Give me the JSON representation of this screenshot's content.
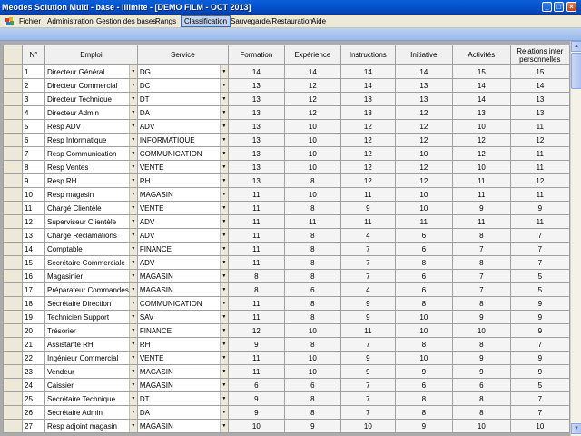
{
  "window": {
    "title": "Meodes Solution Multi - base - Illimite - [DEMO FILM - OCT 2013]",
    "controls": {
      "minimize": "_",
      "maximize": "□",
      "close": "×"
    }
  },
  "menu": {
    "items": [
      {
        "label": "Fichier",
        "active": false
      },
      {
        "label": "Administration",
        "active": false
      },
      {
        "label": "Gestion des bases",
        "active": false
      },
      {
        "label": "Rangs",
        "active": false
      },
      {
        "label": "Classification",
        "active": true
      },
      {
        "label": "Sauvegarde/Restauration",
        "active": false
      },
      {
        "label": "Aide",
        "active": false
      }
    ]
  },
  "grid": {
    "headers": {
      "num": "N°",
      "emploi": "Emploi",
      "service": "Service",
      "formation": "Formation",
      "experience": "Expérience",
      "instructions": "Instructions",
      "initiative": "Initiative",
      "activites": "Activités",
      "relations": "Relations inter personnelles"
    },
    "rows": [
      {
        "n": "1",
        "emploi": "Directeur Général",
        "service": "DG",
        "formation": "14",
        "experience": "14",
        "instructions": "14",
        "initiative": "14",
        "activites": "15",
        "relations": "15"
      },
      {
        "n": "2",
        "emploi": "Directeur Commercial",
        "service": "DC",
        "formation": "13",
        "experience": "12",
        "instructions": "14",
        "initiative": "13",
        "activites": "14",
        "relations": "14"
      },
      {
        "n": "3",
        "emploi": "Directeur Technique",
        "service": "DT",
        "formation": "13",
        "experience": "12",
        "instructions": "13",
        "initiative": "13",
        "activites": "14",
        "relations": "13"
      },
      {
        "n": "4",
        "emploi": "Directeur Admin",
        "service": "DA",
        "formation": "13",
        "experience": "12",
        "instructions": "13",
        "initiative": "12",
        "activites": "13",
        "relations": "13"
      },
      {
        "n": "5",
        "emploi": "Resp ADV",
        "service": "ADV",
        "formation": "13",
        "experience": "10",
        "instructions": "12",
        "initiative": "12",
        "activites": "10",
        "relations": "11"
      },
      {
        "n": "6",
        "emploi": "Resp Informatique",
        "service": "INFORMATIQUE",
        "formation": "13",
        "experience": "10",
        "instructions": "12",
        "initiative": "12",
        "activites": "12",
        "relations": "12"
      },
      {
        "n": "7",
        "emploi": "Resp Communication",
        "service": "COMMUNICATION",
        "formation": "13",
        "experience": "10",
        "instructions": "12",
        "initiative": "10",
        "activites": "12",
        "relations": "11"
      },
      {
        "n": "8",
        "emploi": "Resp Ventes",
        "service": "VENTE",
        "formation": "13",
        "experience": "10",
        "instructions": "12",
        "initiative": "12",
        "activites": "10",
        "relations": "11"
      },
      {
        "n": "9",
        "emploi": "Resp RH",
        "service": "RH",
        "formation": "13",
        "experience": "8",
        "instructions": "12",
        "initiative": "12",
        "activites": "11",
        "relations": "12"
      },
      {
        "n": "10",
        "emploi": "Resp magasin",
        "service": "MAGASIN",
        "formation": "11",
        "experience": "10",
        "instructions": "11",
        "initiative": "10",
        "activites": "11",
        "relations": "11"
      },
      {
        "n": "11",
        "emploi": "Chargé Clientèle",
        "service": "VENTE",
        "formation": "11",
        "experience": "8",
        "instructions": "9",
        "initiative": "10",
        "activites": "9",
        "relations": "9"
      },
      {
        "n": "12",
        "emploi": "Superviseur Clientèle",
        "service": "ADV",
        "formation": "11",
        "experience": "11",
        "instructions": "11",
        "initiative": "11",
        "activites": "11",
        "relations": "11"
      },
      {
        "n": "13",
        "emploi": "Chargé Réclamations",
        "service": "ADV",
        "formation": "11",
        "experience": "8",
        "instructions": "4",
        "initiative": "6",
        "activites": "8",
        "relations": "7"
      },
      {
        "n": "14",
        "emploi": "Comptable",
        "service": "FINANCE",
        "formation": "11",
        "experience": "8",
        "instructions": "7",
        "initiative": "6",
        "activites": "7",
        "relations": "7"
      },
      {
        "n": "15",
        "emploi": "Secrétaire Commerciale",
        "service": "ADV",
        "formation": "11",
        "experience": "8",
        "instructions": "7",
        "initiative": "8",
        "activites": "8",
        "relations": "7"
      },
      {
        "n": "16",
        "emploi": "Magasinier",
        "service": "MAGASIN",
        "formation": "8",
        "experience": "8",
        "instructions": "7",
        "initiative": "6",
        "activites": "7",
        "relations": "5"
      },
      {
        "n": "17",
        "emploi": "Préparateur Commandes",
        "service": "MAGASIN",
        "formation": "8",
        "experience": "6",
        "instructions": "4",
        "initiative": "6",
        "activites": "7",
        "relations": "5"
      },
      {
        "n": "18",
        "emploi": "Secrétaire Direction",
        "service": "COMMUNICATION",
        "formation": "11",
        "experience": "8",
        "instructions": "9",
        "initiative": "8",
        "activites": "8",
        "relations": "9"
      },
      {
        "n": "19",
        "emploi": "Technicien Support",
        "service": "SAV",
        "formation": "11",
        "experience": "8",
        "instructions": "9",
        "initiative": "10",
        "activites": "9",
        "relations": "9"
      },
      {
        "n": "20",
        "emploi": "Trésorier",
        "service": "FINANCE",
        "formation": "12",
        "experience": "10",
        "instructions": "11",
        "initiative": "10",
        "activites": "10",
        "relations": "9"
      },
      {
        "n": "21",
        "emploi": "Assistante RH",
        "service": "RH",
        "formation": "9",
        "experience": "8",
        "instructions": "7",
        "initiative": "8",
        "activites": "8",
        "relations": "7"
      },
      {
        "n": "22",
        "emploi": "Ingénieur Commercial",
        "service": "VENTE",
        "formation": "11",
        "experience": "10",
        "instructions": "9",
        "initiative": "10",
        "activites": "9",
        "relations": "9"
      },
      {
        "n": "23",
        "emploi": "Vendeur",
        "service": "MAGASIN",
        "formation": "11",
        "experience": "10",
        "instructions": "9",
        "initiative": "9",
        "activites": "9",
        "relations": "9"
      },
      {
        "n": "24",
        "emploi": "Caissier",
        "service": "MAGASIN",
        "formation": "6",
        "experience": "6",
        "instructions": "7",
        "initiative": "6",
        "activites": "6",
        "relations": "5"
      },
      {
        "n": "25",
        "emploi": "Secrétaire Technique",
        "service": "DT",
        "formation": "9",
        "experience": "8",
        "instructions": "7",
        "initiative": "8",
        "activites": "8",
        "relations": "7"
      },
      {
        "n": "26",
        "emploi": "Secrétaire Admin",
        "service": "DA",
        "formation": "9",
        "experience": "8",
        "instructions": "7",
        "initiative": "8",
        "activites": "8",
        "relations": "7"
      },
      {
        "n": "27",
        "emploi": "Resp adjoint magasin",
        "service": "MAGASIN",
        "formation": "10",
        "experience": "9",
        "instructions": "10",
        "initiative": "9",
        "activites": "10",
        "relations": "10"
      }
    ]
  },
  "icons": {
    "dropdown": "chevron-down-icon",
    "app": "app-icon"
  },
  "colors": {
    "titlebar": "#0554d0",
    "menu_active_bg": "#c1d2ee",
    "toolband": "#b9d1f5",
    "grid_bg": "#ababab"
  }
}
